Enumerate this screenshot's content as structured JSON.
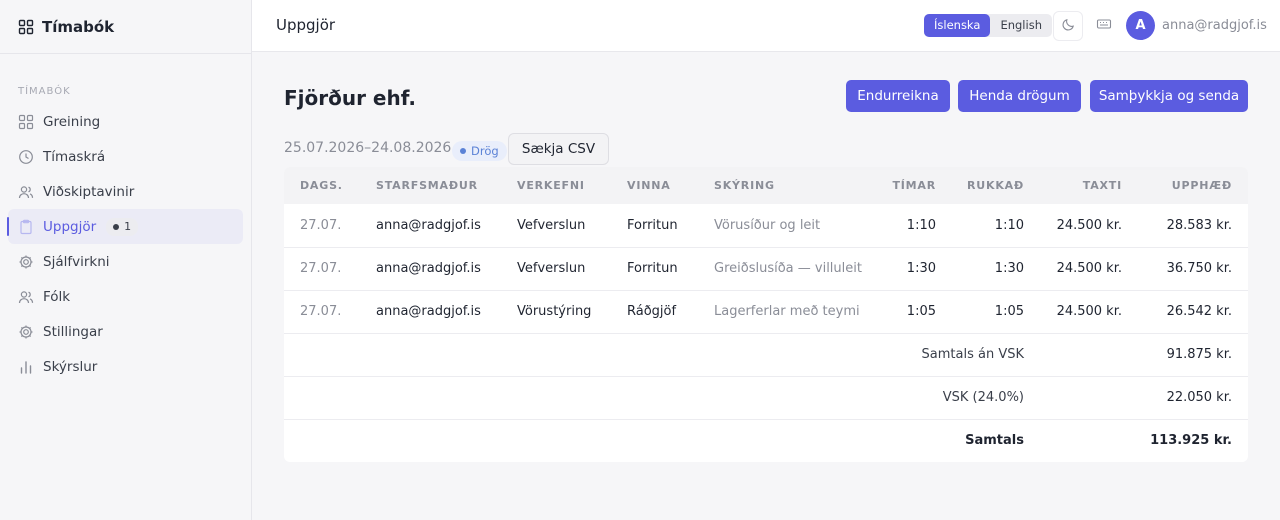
{
  "app": {
    "title": "Tímabók"
  },
  "sidebar": {
    "section_label": "TÍMABÓK",
    "items": [
      {
        "label": "Greining",
        "icon": "grid-icon"
      },
      {
        "label": "Tímaskrá",
        "icon": "clock-icon"
      },
      {
        "label": "Viðskiptavinir",
        "icon": "users-icon"
      },
      {
        "label": "Uppgjör",
        "icon": "clipboard-icon",
        "active": true,
        "badge": "1"
      },
      {
        "label": "Sjálfvirkni",
        "icon": "gear-icon"
      },
      {
        "label": "Fólk",
        "icon": "people-icon"
      },
      {
        "label": "Stillingar",
        "icon": "gear-icon"
      },
      {
        "label": "Skýrslur",
        "icon": "bar-chart-icon"
      }
    ]
  },
  "topbar": {
    "title": "Uppgjör",
    "lang_is": "Íslenska",
    "lang_en": "English",
    "avatar_initial": "A",
    "user_email": "anna@radgjof.is"
  },
  "invoice": {
    "client": "Fjörður ehf.",
    "period": "25.07.2026–24.08.2026",
    "status": "Drög",
    "buttons": {
      "recalc": "Endurreikna",
      "discard": "Henda drögum",
      "approve": "Samþykkja og senda",
      "csv": "Sækja CSV"
    },
    "columns": [
      "DAGS.",
      "STARFSMAÐUR",
      "VERKEFNI",
      "VINNA",
      "SKÝRING",
      "TÍMAR",
      "RUKKAÐ",
      "TAXTI",
      "UPPHÆÐ"
    ],
    "rows": [
      {
        "date": "27.07.",
        "employee": "anna@radgjof.is",
        "project": "Vefverslun",
        "work": "Forritun",
        "description": "Vörusíður og leit",
        "hours": "1:10",
        "billed": "1:10",
        "rate": "24.500 kr.",
        "amount": "28.583 kr."
      },
      {
        "date": "27.07.",
        "employee": "anna@radgjof.is",
        "project": "Vefverslun",
        "work": "Forritun",
        "description": "Greiðslusíða — villuleit",
        "hours": "1:30",
        "billed": "1:30",
        "rate": "24.500 kr.",
        "amount": "36.750 kr."
      },
      {
        "date": "27.07.",
        "employee": "anna@radgjof.is",
        "project": "Vörustýring",
        "work": "Ráðgjöf",
        "description": "Lagerferlar með teymi",
        "hours": "1:05",
        "billed": "1:05",
        "rate": "24.500 kr.",
        "amount": "26.542 kr."
      }
    ],
    "totals": {
      "subtotal_label": "Samtals án VSK",
      "subtotal": "91.875 kr.",
      "vat_label": "VSK (24.0%)",
      "vat": "22.050 kr.",
      "total_label": "Samtals",
      "total": "113.925 kr."
    }
  },
  "colors": {
    "accent": "#5b5ce0",
    "status": "#5b82d6"
  }
}
